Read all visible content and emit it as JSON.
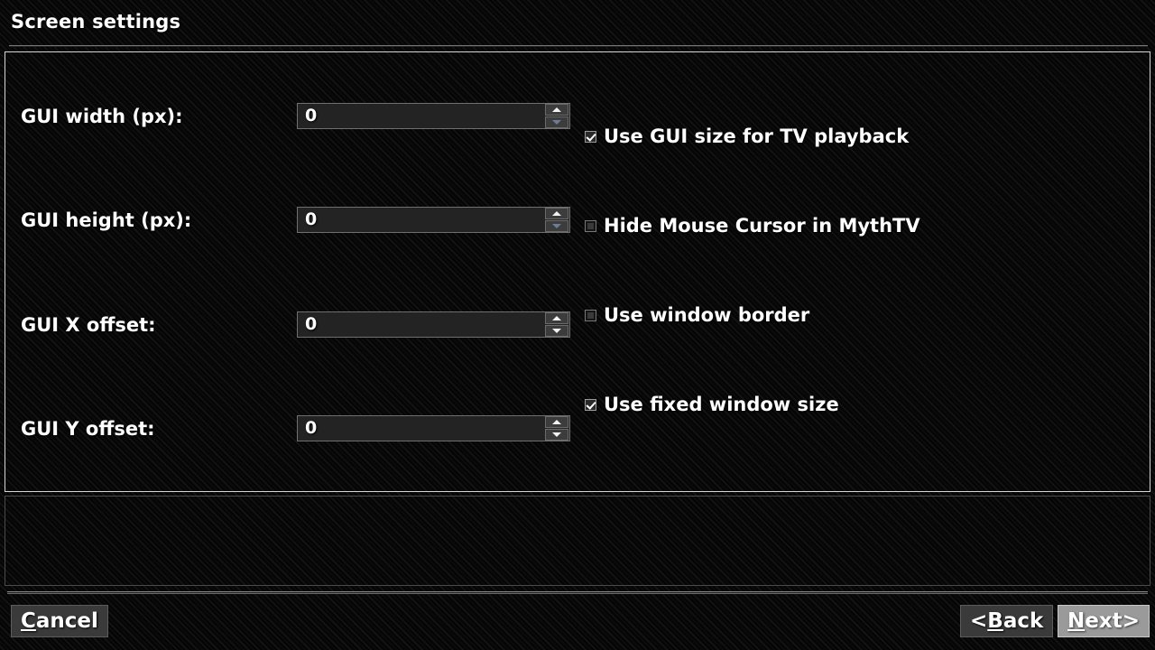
{
  "window": {
    "title": "Screen settings"
  },
  "settings": {
    "rows": [
      {
        "label": "GUI width (px):",
        "value": "0",
        "name": "gui-width"
      },
      {
        "label": "GUI height (px):",
        "value": "0",
        "name": "gui-height"
      },
      {
        "label": "GUI X offset:",
        "value": "0",
        "name": "gui-x-offset"
      },
      {
        "label": "GUI Y offset:",
        "value": "0",
        "name": "gui-y-offset"
      }
    ]
  },
  "checkboxes": [
    {
      "label": "Use GUI size for TV playback",
      "checked": true
    },
    {
      "label": "Hide Mouse Cursor in MythTV",
      "checked": false
    },
    {
      "label": "Use window border",
      "checked": false
    },
    {
      "label": "Use fixed window size",
      "checked": true
    }
  ],
  "buttons": {
    "cancel": {
      "accel": "C",
      "rest": "ancel",
      "focused": false
    },
    "back": {
      "prefix": "< ",
      "accel": "B",
      "rest": "ack",
      "suffix": "",
      "focused": false
    },
    "next": {
      "prefix": "",
      "accel": "N",
      "rest": "ext",
      "suffix": " >",
      "focused": true
    }
  },
  "icons": {
    "spin_up": "triangle-up-icon",
    "spin_down": "triangle-down-icon",
    "check": "check-icon"
  },
  "colors": {
    "background": "#050505",
    "panel_border": "#d6d6d6",
    "panel_border_dim": "#4a4a4a",
    "text": "#ffffff",
    "field_background": "#232323",
    "button_normal": "#3a3a3a",
    "button_focused": "#9a9a9a",
    "spin_arrow": "#f2f2f2",
    "spin_arrow_dim": "#6b7d93"
  }
}
